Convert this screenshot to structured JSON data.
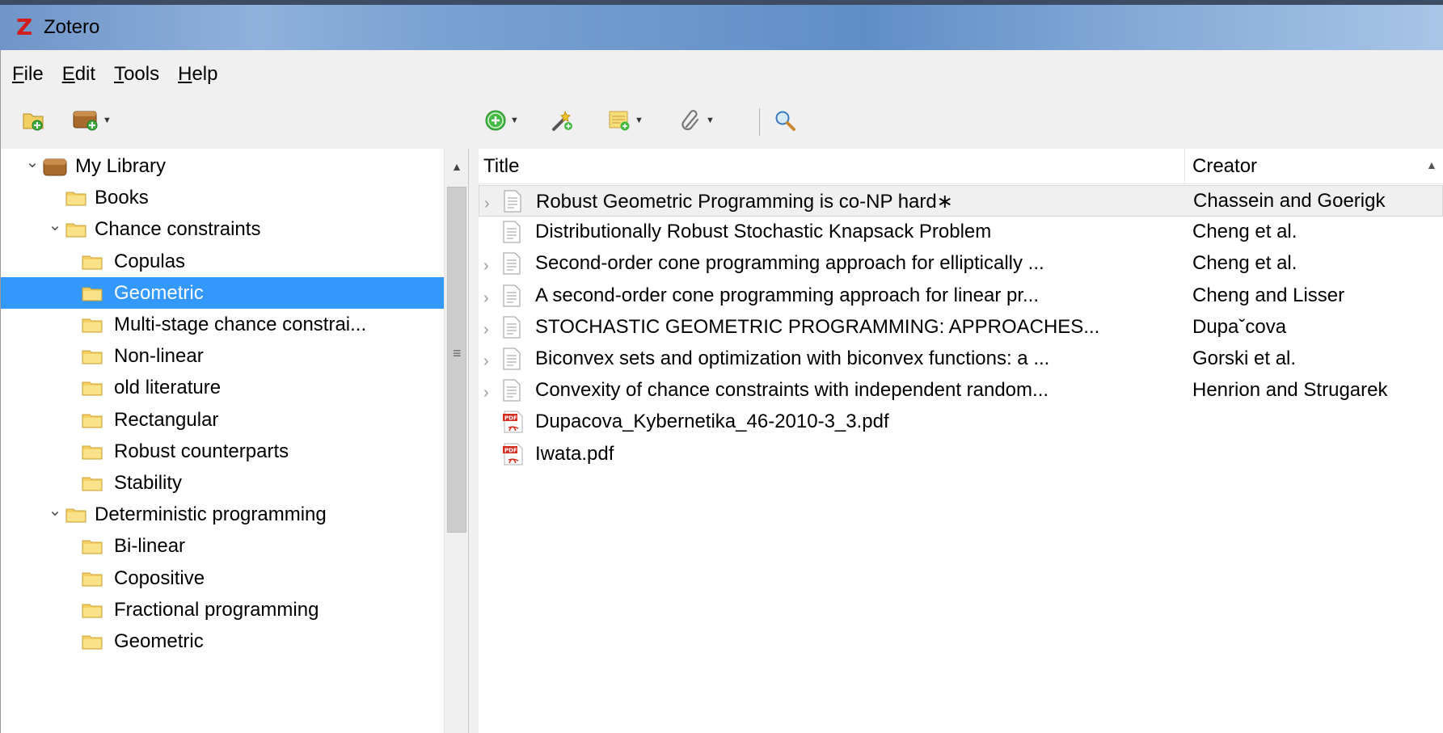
{
  "window": {
    "title": "Zotero",
    "logo_letter": "Z"
  },
  "menubar": [
    {
      "label": "File",
      "mnemonic": "F",
      "rest": "ile"
    },
    {
      "label": "Edit",
      "mnemonic": "E",
      "rest": "dit"
    },
    {
      "label": "Tools",
      "mnemonic": "T",
      "rest": "ools"
    },
    {
      "label": "Help",
      "mnemonic": "H",
      "rest": "elp"
    }
  ],
  "toolbar": {
    "left_icons": [
      "new-collection-icon",
      "new-library-icon"
    ],
    "right_icons": [
      "new-item-icon",
      "add-by-identifier-icon",
      "new-note-icon",
      "add-attachment-icon",
      "advanced-search-icon"
    ]
  },
  "collections": [
    {
      "label": "My Library",
      "depth": 0,
      "expanded": true,
      "type": "library"
    },
    {
      "label": "Books",
      "depth": 1,
      "type": "folder"
    },
    {
      "label": "Chance constraints",
      "depth": 1,
      "expanded": true,
      "type": "folder"
    },
    {
      "label": "Copulas",
      "depth": 2,
      "type": "folder"
    },
    {
      "label": "Geometric",
      "depth": 2,
      "type": "folder",
      "selected": true
    },
    {
      "label": "Multi-stage chance constrai...",
      "depth": 2,
      "type": "folder"
    },
    {
      "label": "Non-linear",
      "depth": 2,
      "type": "folder"
    },
    {
      "label": "old literature",
      "depth": 2,
      "type": "folder"
    },
    {
      "label": "Rectangular",
      "depth": 2,
      "type": "folder"
    },
    {
      "label": "Robust counterparts",
      "depth": 2,
      "type": "folder"
    },
    {
      "label": "Stability",
      "depth": 2,
      "type": "folder"
    },
    {
      "label": "Deterministic programming",
      "depth": 1,
      "expanded": true,
      "type": "folder"
    },
    {
      "label": "Bi-linear",
      "depth": 2,
      "type": "folder"
    },
    {
      "label": "Copositive",
      "depth": 2,
      "type": "folder"
    },
    {
      "label": "Fractional programming",
      "depth": 2,
      "type": "folder"
    },
    {
      "label": "Geometric",
      "depth": 2,
      "type": "folder"
    }
  ],
  "items_table": {
    "columns": {
      "title": "Title",
      "creator": "Creator"
    },
    "rows": [
      {
        "title": "Robust Geometric Programming is co-NP hard∗",
        "creator": "Chassein and Goerigk",
        "type": "document",
        "has_children": true,
        "current": true
      },
      {
        "title": "Distributionally Robust Stochastic Knapsack Problem",
        "creator": "Cheng et al.",
        "type": "document",
        "has_children": false
      },
      {
        "title": "Second-order cone programming approach for elliptically ...",
        "creator": "Cheng et al.",
        "type": "document",
        "has_children": true
      },
      {
        "title": "A second-order cone programming approach for linear pr...",
        "creator": "Cheng and Lisser",
        "type": "document",
        "has_children": true
      },
      {
        "title": "STOCHASTIC GEOMETRIC PROGRAMMING: APPROACHES...",
        "creator": "Dupaˇcova",
        "type": "document",
        "has_children": true
      },
      {
        "title": "Biconvex sets and optimization with biconvex functions: a ...",
        "creator": "Gorski et al.",
        "type": "document",
        "has_children": true
      },
      {
        "title": "Convexity of chance constraints with independent random...",
        "creator": "Henrion and Strugarek",
        "type": "document",
        "has_children": true
      },
      {
        "title": "Dupacova_Kybernetika_46-2010-3_3.pdf",
        "creator": "",
        "type": "pdf",
        "has_children": false
      },
      {
        "title": "Iwata.pdf",
        "creator": "",
        "type": "pdf",
        "has_children": false
      }
    ]
  },
  "colors": {
    "selection": "#3399ff",
    "folder": "#f5d060",
    "title_bar": "#7aa2d2"
  }
}
